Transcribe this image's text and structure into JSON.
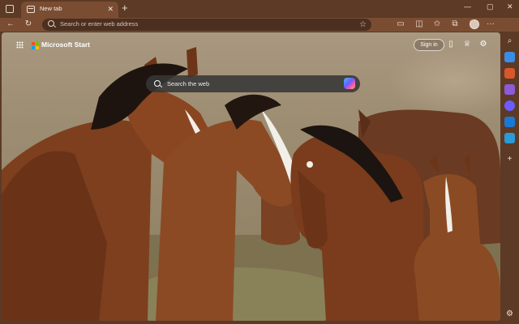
{
  "browser": {
    "tab": {
      "title": "New tab",
      "close_glyph": "✕"
    },
    "new_tab_glyph": "+",
    "window_controls": {
      "minimize": "—",
      "maximize": "▢",
      "close": "✕"
    },
    "nav": {
      "back": "←",
      "refresh": "↻"
    },
    "omnibox": {
      "placeholder": "Search or enter web address",
      "favorite_glyph": "☆"
    },
    "toolbar_icons": [
      "reading-mode-icon",
      "refresh-alt-icon",
      "favorites-icon",
      "collections-icon",
      "browser-essentials-icon",
      "profile-avatar",
      "more-icon"
    ],
    "more_glyph": "···"
  },
  "page": {
    "brand": "Microsoft Start",
    "sign_in": "Sign in",
    "search_placeholder": "Search the web",
    "top_icons": [
      "phone-icon",
      "rewards-icon",
      "settings-icon"
    ]
  },
  "sidebar": {
    "items": [
      "search-icon",
      "shopping-icon",
      "tools-icon",
      "games-icon",
      "copilot-icon",
      "outlook-icon",
      "send-icon",
      "add-icon"
    ],
    "add_glyph": "+",
    "settings_glyph": "⚙"
  },
  "colors": {
    "frame": "#5c3a25",
    "toolbar": "#7a4d33",
    "omnibox": "#4b2f20",
    "search_box": "#373737",
    "ms_red": "#f25022",
    "ms_green": "#7fba00",
    "ms_blue": "#00a4ef",
    "ms_yellow": "#ffb900"
  },
  "background_image": "wild horses herd photo"
}
